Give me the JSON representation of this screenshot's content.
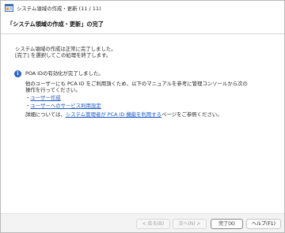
{
  "window": {
    "title": "システム領域の作成・更新 (11 / 11)"
  },
  "header": {
    "title": "「システム領域の作成・更新」の完了"
  },
  "content": {
    "line1": "システム領域の作成は正常に完了しました。",
    "line2": "[完了] を選択してこの処理を終了します。",
    "info_heading": "POA IDの有効化が完了しました。",
    "para1_line1": "他のユーザーにも PCA ID をご利用頂くため、以下のマニュアルを参考に管理コンソールから次の",
    "para1_line2": "操作を行ってください。",
    "bullets": [
      {
        "label": "ユーザー作成"
      },
      {
        "label": "ユーザーへのサービス利用設定"
      }
    ],
    "detail_prefix": "詳細については、",
    "detail_link": "システム管理者が PCA ID 機能を利用する",
    "detail_suffix": "ページをご参照ください。"
  },
  "footer": {
    "back_label": "< 戻る(B)",
    "next_label": "次へ(N) >",
    "finish_label": "完了(X)",
    "help_label": "ヘルプ(F1)"
  },
  "colors": {
    "link": "#1a56c4",
    "info_icon": "#2a62c9"
  }
}
